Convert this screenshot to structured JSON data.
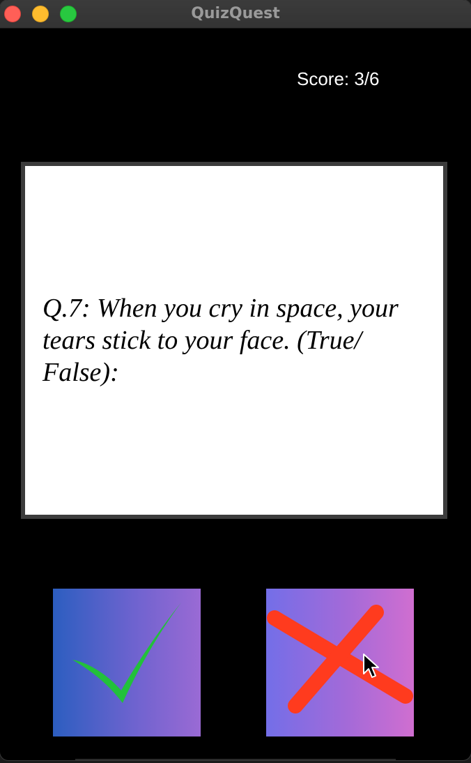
{
  "window": {
    "title": "QuizQuest"
  },
  "score": {
    "label": "Score: 3/6"
  },
  "question": {
    "text": "Q.7: When you cry in space, your tears stick to your face. (True/ False):"
  },
  "answers": {
    "true_icon": "check-icon",
    "false_icon": "x-icon"
  },
  "colors": {
    "background": "#000000",
    "card": "#ffffff",
    "check": "#22c13a",
    "cross": "#ff3b1e"
  }
}
